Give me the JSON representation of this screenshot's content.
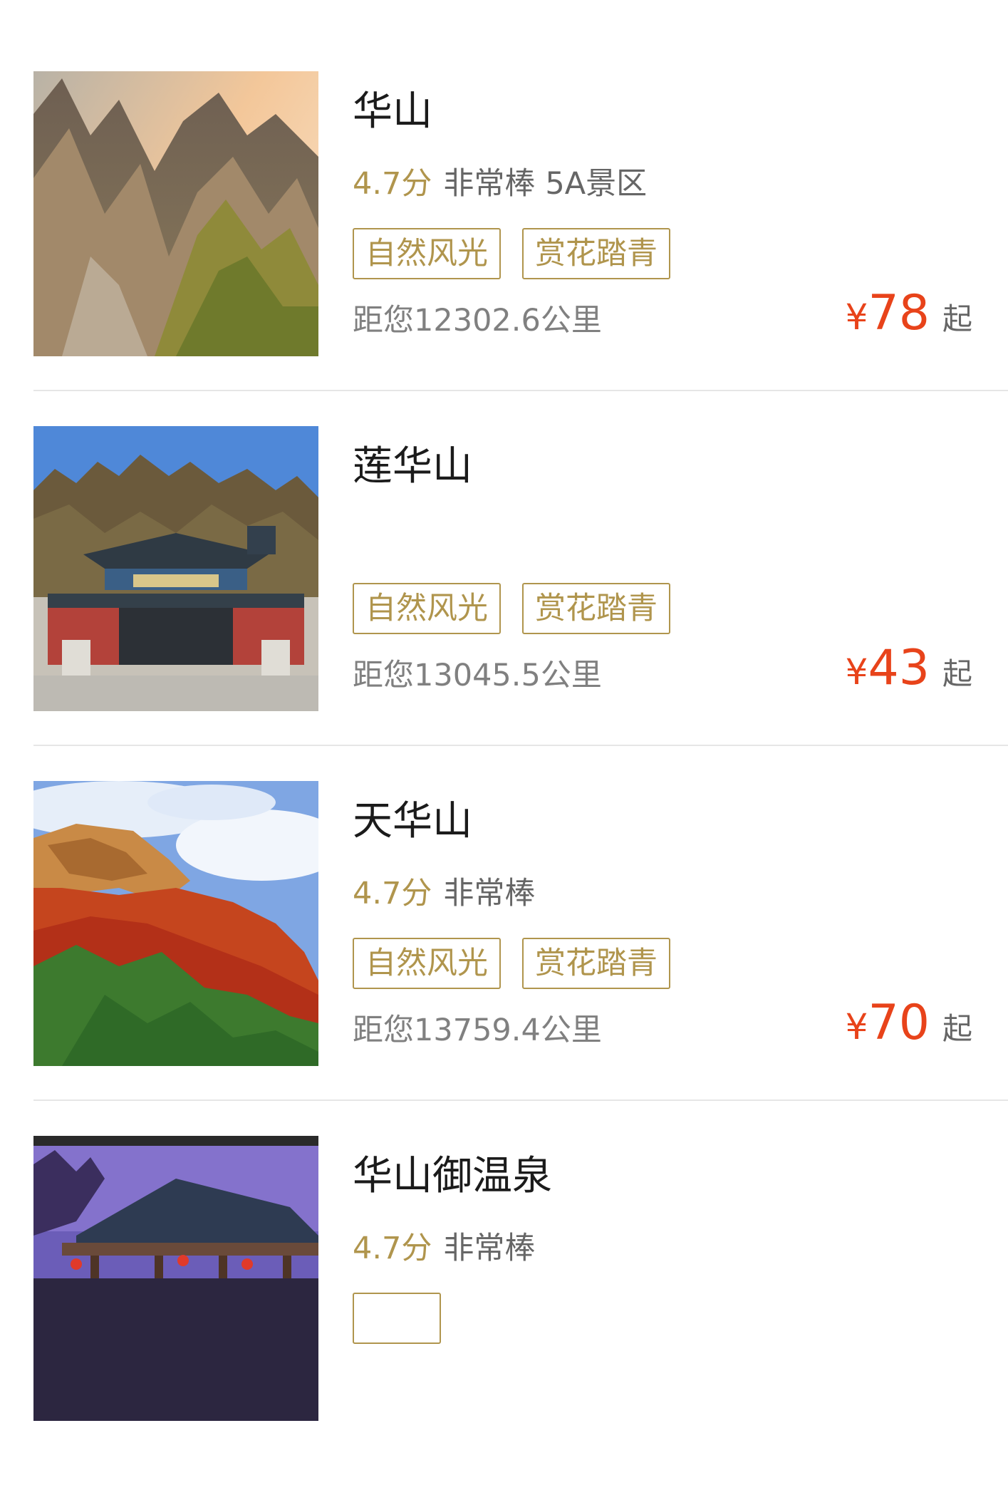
{
  "items": [
    {
      "name": "华山",
      "score": "4.7分",
      "desc": "非常棒",
      "level": "5A景区",
      "tags": [
        "自然风光",
        "赏花踏青"
      ],
      "distance": "距您12302.6公里",
      "price_symbol": "¥",
      "price": "78",
      "price_suffix": "起"
    },
    {
      "name": "莲华山",
      "score": "",
      "desc": "",
      "level": "",
      "tags": [
        "自然风光",
        "赏花踏青"
      ],
      "distance": "距您13045.5公里",
      "price_symbol": "¥",
      "price": "43",
      "price_suffix": "起"
    },
    {
      "name": "天华山",
      "score": "4.7分",
      "desc": "非常棒",
      "level": "",
      "tags": [
        "自然风光",
        "赏花踏青"
      ],
      "distance": "距您13759.4公里",
      "price_symbol": "¥",
      "price": "70",
      "price_suffix": "起"
    },
    {
      "name": "华山御温泉",
      "score": "4.7分",
      "desc": "非常棒",
      "level": "",
      "tags": [],
      "distance": "",
      "price_symbol": "",
      "price": "",
      "price_suffix": ""
    }
  ],
  "colors": {
    "accent_gold": "#b0954d",
    "price_red": "#e8431a",
    "text_dark": "#1b1b1b",
    "text_gray": "#808080",
    "divider": "#e6e6e6"
  }
}
